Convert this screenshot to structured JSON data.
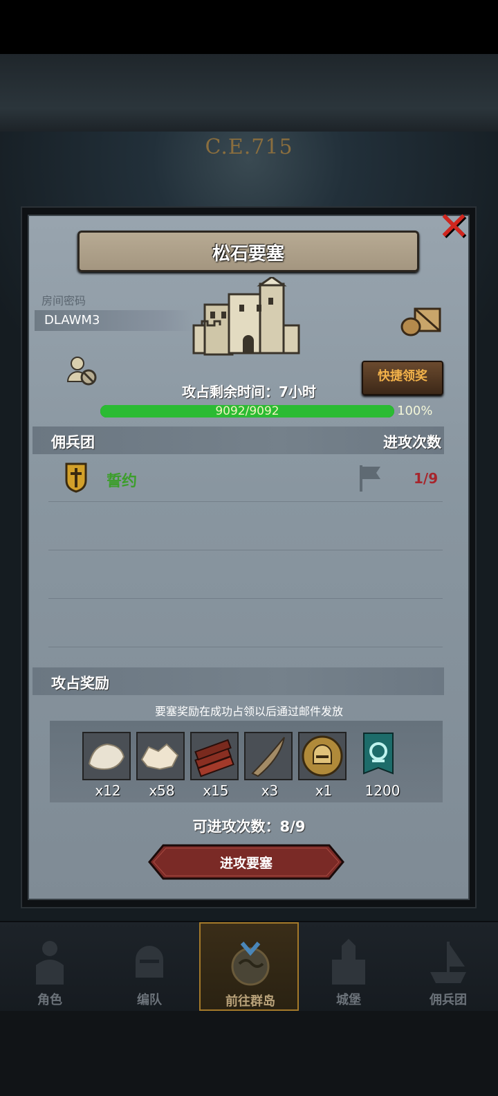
{
  "background": {
    "era_text": "C.E.715"
  },
  "dialog": {
    "title": "松石要塞",
    "room_label": "房间密码",
    "room_code": "DLAWM3",
    "quick_claim_label": "快捷领奖",
    "time_remaining": "攻占剩余时间：7小时",
    "hp_text": "9092/9092",
    "hp_fraction": 1.0,
    "hp_percent_text": "100%",
    "mercenary_header": "佣兵团",
    "attack_count_header": "进攻次数",
    "guilds": [
      {
        "name": "誓约",
        "attacks": "1/9"
      }
    ],
    "reward_header": "攻占奖励",
    "reward_note": "要塞奖励在成功占领以后通过邮件发放",
    "rewards": [
      {
        "icon": "fur-pelt-icon",
        "qty": "x12"
      },
      {
        "icon": "fleece-icon",
        "qty": "x58"
      },
      {
        "icon": "wood-planks-icon",
        "qty": "x15"
      },
      {
        "icon": "horn-icon",
        "qty": "x3"
      },
      {
        "icon": "helmet-coin-icon",
        "qty": "x1"
      },
      {
        "icon": "banner-icon",
        "qty": "1200"
      }
    ],
    "attempts_text": "可进攻次数：8/9",
    "attack_button": "进攻要塞"
  },
  "navbar": [
    {
      "label": "角色",
      "icon": "knight-icon",
      "active": false
    },
    {
      "label": "编队",
      "icon": "helmet-icon",
      "active": false
    },
    {
      "label": "前往群岛",
      "icon": "globe-icon",
      "active": true
    },
    {
      "label": "城堡",
      "icon": "castle-icon",
      "active": false
    },
    {
      "label": "佣兵团",
      "icon": "ship-icon",
      "active": false
    }
  ],
  "colors": {
    "hp_green": "#2bbb33",
    "guild_green": "#3c9e2b",
    "attack_red": "#a7252c",
    "button_gold": "#f2b24a",
    "close_red": "#d0261e"
  }
}
